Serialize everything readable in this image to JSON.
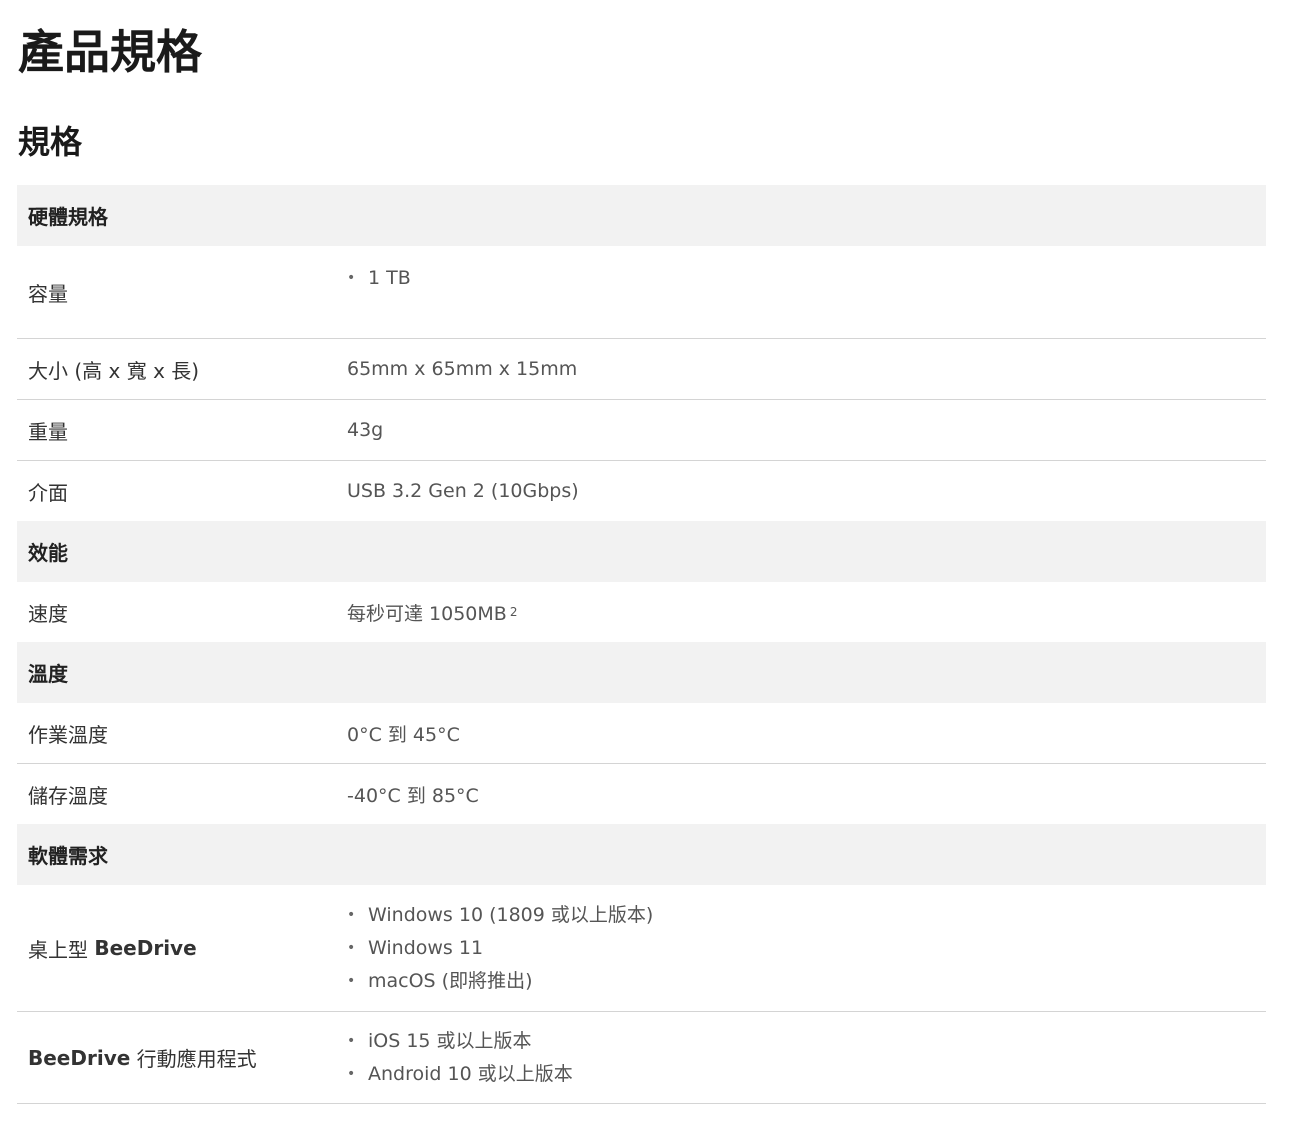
{
  "page_title": "產品規格",
  "section_title": "規格",
  "groups": [
    {
      "title": "硬體規格",
      "rows": [
        {
          "label": "容量",
          "values": [
            "1 TB"
          ]
        },
        {
          "label": "大小 (高 x 寬 x 長)",
          "value": "65mm x 65mm x 15mm"
        },
        {
          "label": "重量",
          "value": "43g"
        },
        {
          "label": "介面",
          "value": "USB 3.2 Gen 2 (10Gbps)"
        }
      ]
    },
    {
      "title": "效能",
      "rows": [
        {
          "label": "速度",
          "value": "每秒可達 1050MB",
          "superscript": "2"
        }
      ]
    },
    {
      "title": "溫度",
      "rows": [
        {
          "label": "作業溫度",
          "value": "0°C 到 45°C"
        },
        {
          "label": "儲存溫度",
          "value": "-40°C 到 85°C"
        }
      ]
    },
    {
      "title": "軟體需求",
      "rows": [
        {
          "label_prefix": "桌上型",
          "label_strong": "BeeDrive",
          "values": [
            "Windows 10 (1809 或以上版本)",
            "Windows 11",
            "macOS (即將推出)"
          ]
        },
        {
          "label_strong": "BeeDrive",
          "label_suffix": "行動應用程式",
          "values": [
            "iOS 15 或以上版本",
            "Android 10 或以上版本"
          ]
        }
      ]
    }
  ]
}
